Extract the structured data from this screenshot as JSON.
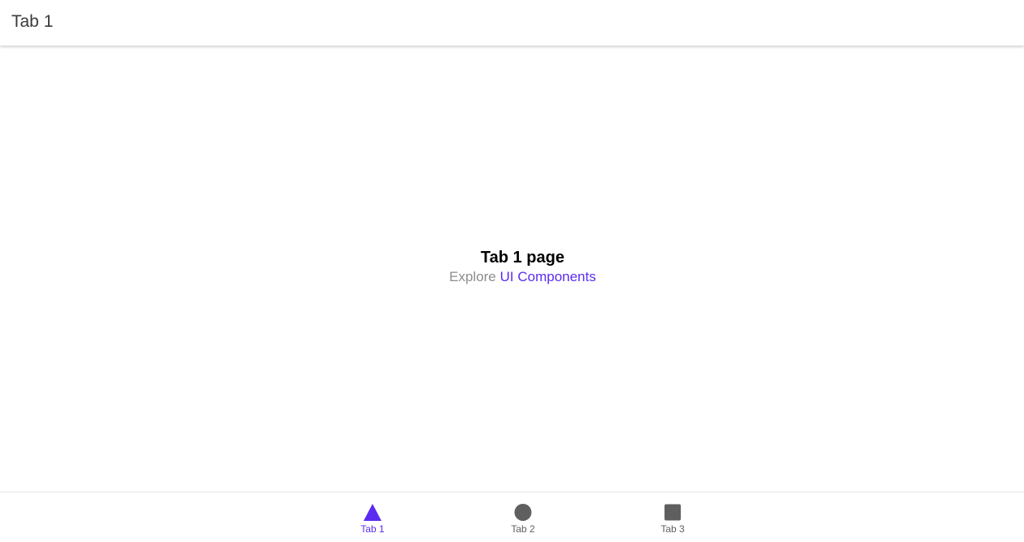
{
  "header": {
    "title": "Tab 1"
  },
  "main": {
    "heading": "Tab 1 page",
    "explore_text": "Explore",
    "link_text": "UI Components"
  },
  "tabs": [
    {
      "label": "Tab 1",
      "icon": "triangle-icon",
      "selected": true
    },
    {
      "label": "Tab 2",
      "icon": "ellipse-icon",
      "selected": false
    },
    {
      "label": "Tab 3",
      "icon": "square-icon",
      "selected": false
    }
  ],
  "colors": {
    "accent": "#5b2bf0",
    "inactive_icon": "#5f5f5f",
    "inactive_label": "#5f5f5f",
    "muted_text": "#8c8c8c"
  }
}
